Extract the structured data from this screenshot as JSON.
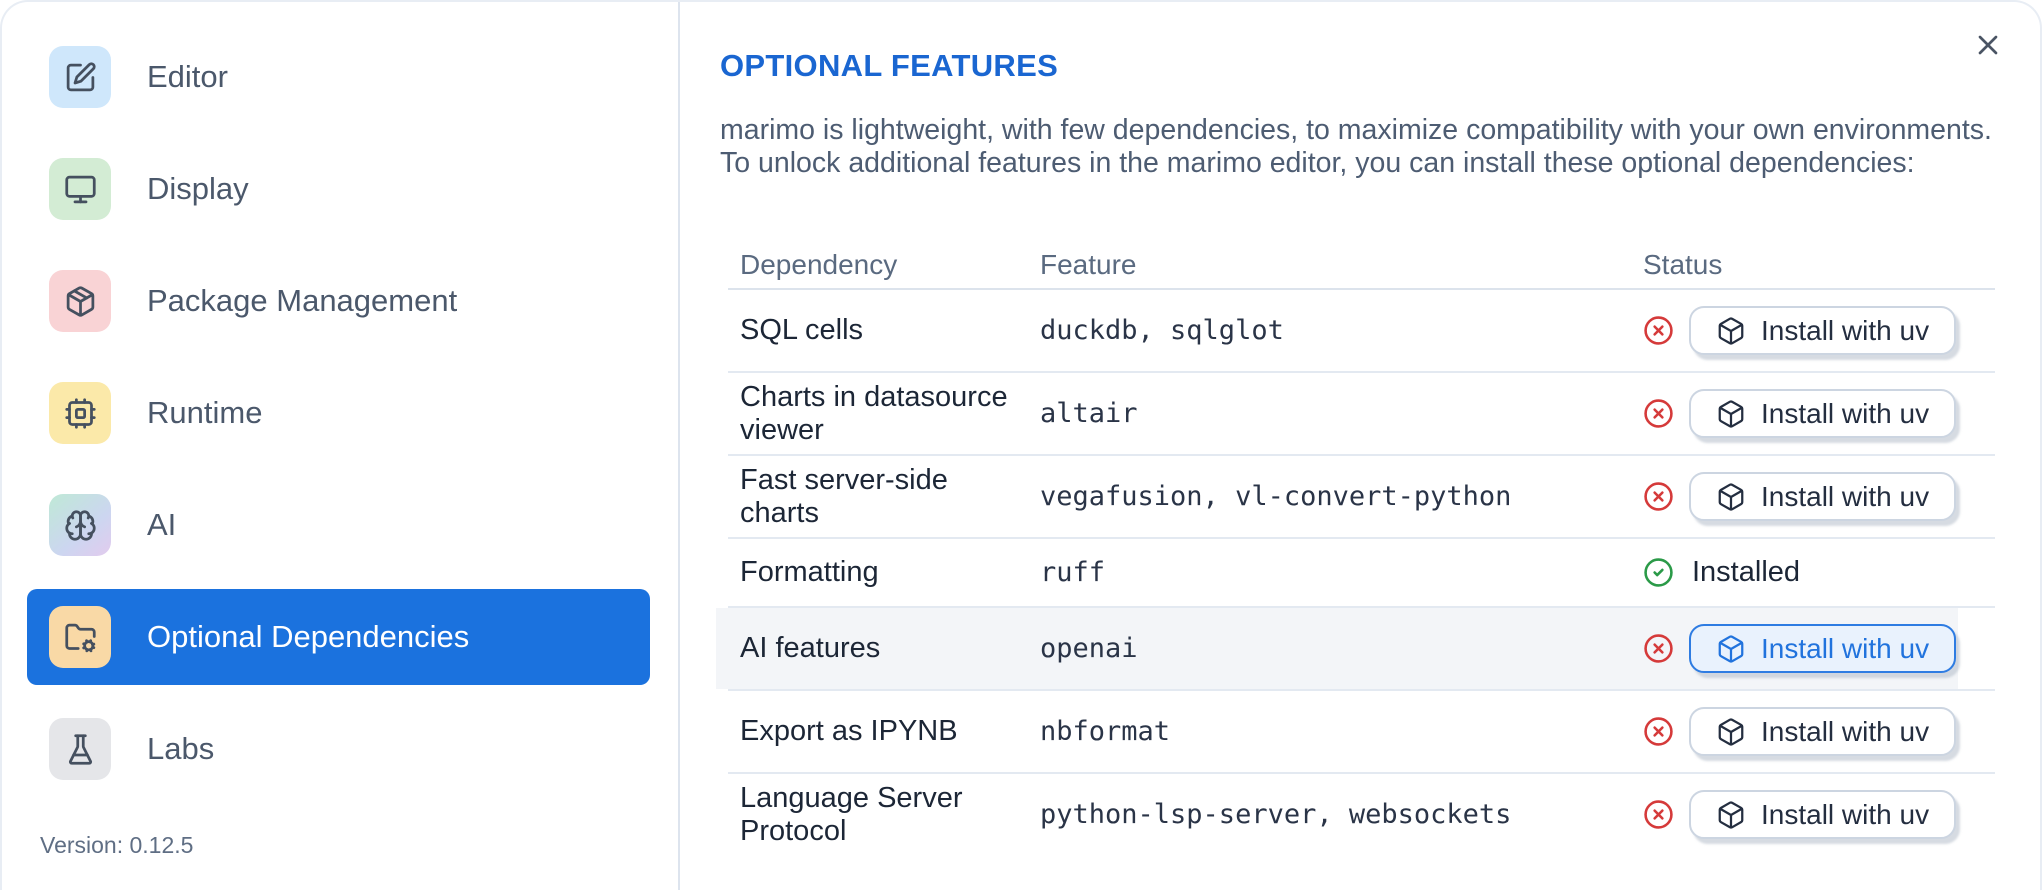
{
  "app": {
    "version_label": "Version: 0.12.5"
  },
  "colors": {
    "selected_item_bg": "#1b72de",
    "title_blue": "#1a66d1",
    "danger_red": "#d53a3a",
    "success_green": "#2b9a48",
    "primary_button_blue": "#2173dd",
    "row_highlight_bg": "#f3f5f8",
    "divider": "#dde4ee"
  },
  "sidebar": {
    "items": [
      {
        "label": "Editor",
        "icon": "square-pen-icon",
        "icon_bg": "#cfe7fb",
        "selected": false
      },
      {
        "label": "Display",
        "icon": "monitor-icon",
        "icon_bg": "#d3ecd4",
        "selected": false
      },
      {
        "label": "Package Management",
        "icon": "package-icon",
        "icon_bg": "#f9d3d5",
        "selected": false
      },
      {
        "label": "Runtime",
        "icon": "cpu-icon",
        "icon_bg": "#fbe9a9",
        "selected": false
      },
      {
        "label": "AI",
        "icon": "brain-icon",
        "icon_bg": "linear-gradient(140deg,#bfe9d6 0%,#ccd6f0 60%,#e2cbee 100%)",
        "selected": false
      },
      {
        "label": "Optional Dependencies",
        "icon": "folder-cog-icon",
        "icon_bg": "#f9d9a6",
        "selected": true
      },
      {
        "label": "Labs",
        "icon": "flask-icon",
        "icon_bg": "#e5e6e9",
        "selected": false
      }
    ]
  },
  "dialog": {
    "title": "OPTIONAL FEATURES",
    "description_line1": "marimo is lightweight, with few dependencies, to maximize compatibility with your own environments.",
    "description_line2": "To unlock additional features in the marimo editor, you can install these optional dependencies:",
    "close_icon": "x-icon"
  },
  "table": {
    "headers": [
      "Dependency",
      "Feature",
      "Status"
    ],
    "installed_label": "Installed",
    "install_button_label": "Install with uv",
    "install_button_icon": "box-icon",
    "status_missing_icon": "circle-x-icon",
    "status_installed_icon": "circle-check-icon",
    "rows": [
      {
        "dependency": "SQL cells",
        "feature": "duckdb, sqlglot",
        "status": "missing",
        "highlighted": false
      },
      {
        "dependency": "Charts in datasource viewer",
        "feature": "altair",
        "status": "missing",
        "highlighted": false
      },
      {
        "dependency": "Fast server-side charts",
        "feature": "vegafusion, vl-convert-python",
        "status": "missing",
        "highlighted": false
      },
      {
        "dependency": "Formatting",
        "feature": "ruff",
        "status": "installed",
        "highlighted": false
      },
      {
        "dependency": "AI features",
        "feature": "openai",
        "status": "missing",
        "highlighted": true
      },
      {
        "dependency": "Export as IPYNB",
        "feature": "nbformat",
        "status": "missing",
        "highlighted": false
      },
      {
        "dependency": "Language Server Protocol",
        "feature": "python-lsp-server, websockets",
        "status": "missing",
        "highlighted": false
      }
    ]
  }
}
